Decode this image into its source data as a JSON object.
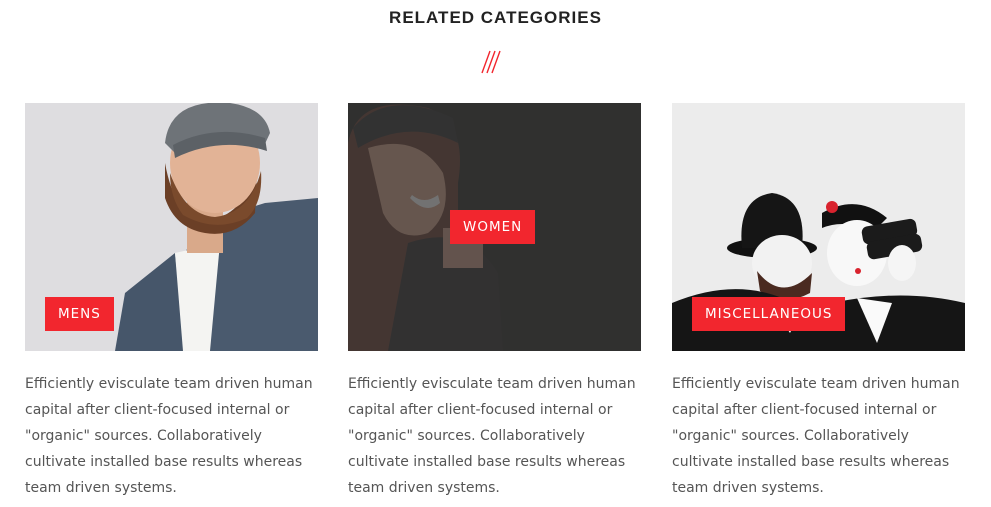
{
  "section": {
    "title": "RELATED CATEGORIES"
  },
  "accent_color": "#f2262e",
  "categories": [
    {
      "label": "MENS",
      "photo": "man-with-beanie-photo",
      "description": "Efficiently evisculate team driven human capital after client-focused internal or \"organic\" sources. Collaboratively cultivate installed base results whereas team driven systems."
    },
    {
      "label": "WOMEN",
      "photo": "woman-laughing-photo",
      "description": "Efficiently evisculate team driven human capital after client-focused internal or \"organic\" sources. Collaboratively cultivate installed base results whereas team driven systems."
    },
    {
      "label": "MISCELLANEOUS",
      "photo": "mimes-with-binoculars-photo",
      "description": "Efficiently evisculate team driven human capital after client-focused internal or \"organic\" sources. Collaboratively cultivate installed base results whereas team driven systems."
    }
  ]
}
